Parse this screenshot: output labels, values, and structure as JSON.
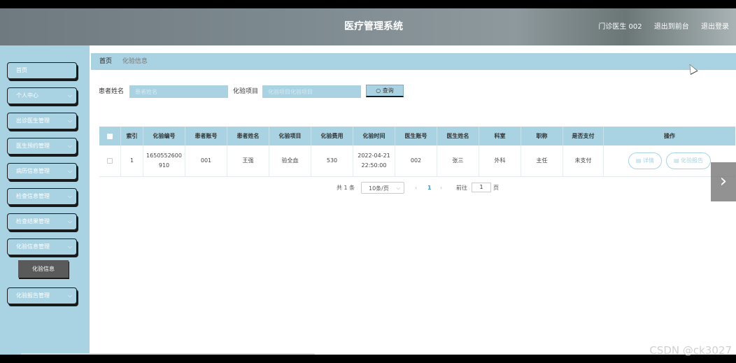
{
  "header": {
    "title": "医疗管理系统",
    "user": "门诊医生 002",
    "goto_front": "退出到前台",
    "logout": "退出登录"
  },
  "sidebar": {
    "items": [
      {
        "label": "首页",
        "has_chevron": false
      },
      {
        "label": "个人中心",
        "has_chevron": true
      },
      {
        "label": "出诊医生管理",
        "has_chevron": true
      },
      {
        "label": "医生预约管理",
        "has_chevron": true
      },
      {
        "label": "病历信息管理",
        "has_chevron": true
      },
      {
        "label": "检查信息管理",
        "has_chevron": true
      },
      {
        "label": "检查结果管理",
        "has_chevron": true
      },
      {
        "label": "化验信息管理",
        "has_chevron": true
      },
      {
        "label": "化验报告管理",
        "has_chevron": true
      }
    ],
    "active_sub": "化验信息"
  },
  "breadcrumb": {
    "home": "首页",
    "current": "化验信息"
  },
  "search": {
    "patient_label": "患者姓名",
    "patient_placeholder": "患者姓名",
    "item_label": "化验项目",
    "item_placeholder": "化验项目化验项目",
    "button": "查询"
  },
  "table": {
    "headers": [
      "索引",
      "化验编号",
      "患者账号",
      "患者姓名",
      "化验项目",
      "化验费用",
      "化验时间",
      "医生账号",
      "医生姓名",
      "科室",
      "职称",
      "是否支付",
      "操作"
    ],
    "rows": [
      {
        "index": "1",
        "code": "1650552600910",
        "patient_account": "001",
        "patient_name": "王强",
        "item": "验全血",
        "fee": "530",
        "time": "2022-04-21 22:50:00",
        "doctor_account": "002",
        "doctor_name": "张三",
        "dept": "外科",
        "title": "主任",
        "paid": "未支付",
        "detail_btn": "详情",
        "report_btn": "化验报告"
      }
    ]
  },
  "pager": {
    "total": "共 1 条",
    "page_size": "10条/页",
    "current_page": "1",
    "goto_label": "前往",
    "goto_value": "1",
    "page_unit": "页"
  },
  "watermark": "CSDN @ck3027",
  "colors": {
    "accent": "#a9d3e2",
    "header": "#7d8a90",
    "active_sub": "#5a5a5a"
  }
}
